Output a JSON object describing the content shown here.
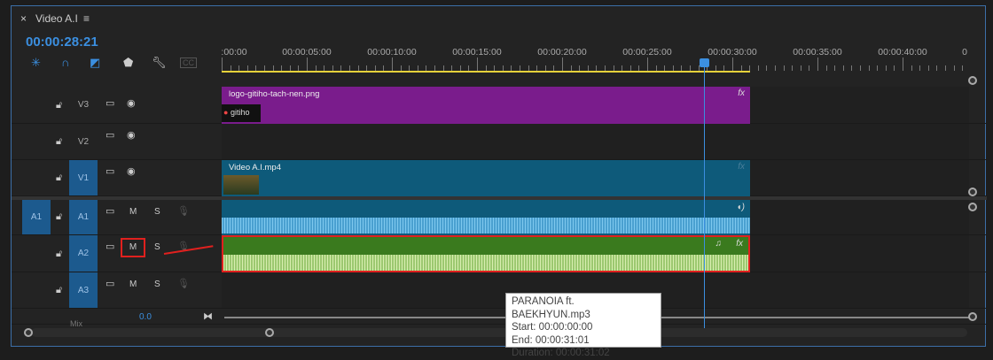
{
  "panel": {
    "close": "×",
    "title": "Video A.I",
    "menu": "≡",
    "timecode": "00:00:28:21"
  },
  "tools": [
    "snap-icon",
    "magnet-icon",
    "linked-selection-icon",
    "marker-icon",
    "wrench-icon",
    "captions-icon"
  ],
  "captions_label": "CC",
  "ruler": {
    "labels": [
      ":00:00",
      "00:00:05:00",
      "00:00:10:00",
      "00:00:15:00",
      "00:00:20:00",
      "00:00:25:00",
      "00:00:30:00",
      "00:00:35:00",
      "00:00:40:00",
      "0"
    ],
    "playhead_seconds": 28.7,
    "work_area_end_seconds": 31
  },
  "tracks": {
    "v3": {
      "name": "V3"
    },
    "v2": {
      "name": "V2"
    },
    "v1": {
      "name": "V1",
      "source": ""
    },
    "a1": {
      "name": "A1",
      "source": "A1"
    },
    "a2": {
      "name": "A2"
    },
    "a3": {
      "name": "A3"
    },
    "mix": {
      "name": "Mix",
      "value": "0.0"
    },
    "m": "M",
    "s": "S"
  },
  "clips": {
    "logo": {
      "name": "logo-gitiho-tach-nen.png",
      "thumb": "gitiho",
      "fx": "fx",
      "color": "#7a1c8c"
    },
    "video": {
      "name": "Video A.I.mp4",
      "fx": "fx",
      "color": "#0e5a7a"
    },
    "audio1": {
      "fx": "",
      "color": "#0e5a7a"
    },
    "audio2": {
      "fx": "fx",
      "color": "#3a7a1e"
    }
  },
  "tooltip": {
    "title": "PARANOIA ft. BAEKHYUN.mp3",
    "start": "Start: 00:00:00:00",
    "end": "End: 00:00:31:01",
    "duration": "Duration: 00:00:31:02"
  }
}
